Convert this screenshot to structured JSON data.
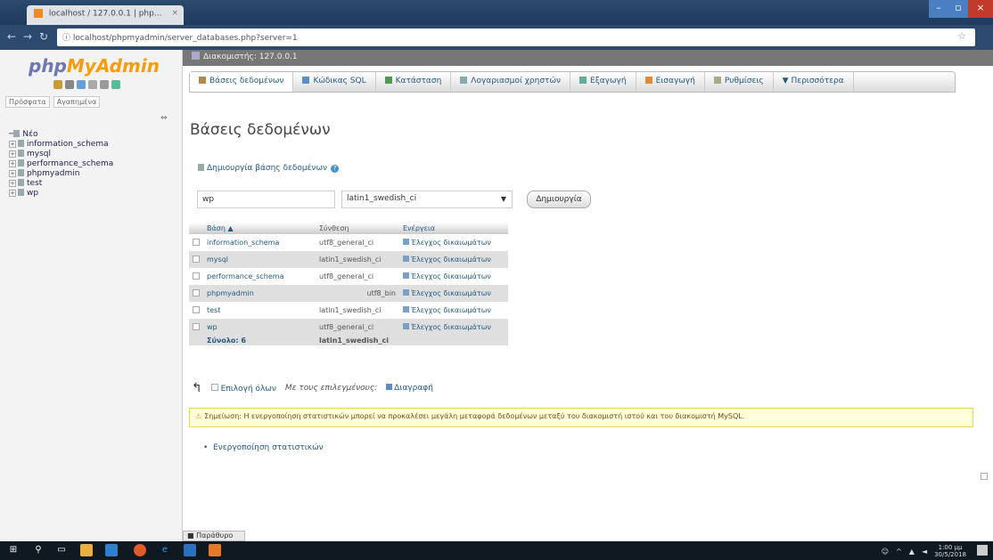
{
  "browser": {
    "tab_title": "localhost / 127.0.0.1 | php...",
    "address": "localhost/phpmyadmin/server_databases.php?server=1"
  },
  "sidebar": {
    "logo_part1": "php",
    "logo_part2": "MyAdmin",
    "tabs": [
      "Πρόσφατα",
      "Αγαπημένα"
    ],
    "tree": [
      "Νέο",
      "information_schema",
      "mysql",
      "performance_schema",
      "phpmyadmin",
      "test",
      "wp"
    ]
  },
  "breadcrumb": "Διακομιστής: 127.0.0.1",
  "menu": [
    {
      "label": "Βάσεις δεδομένων",
      "color": "#b08a4a"
    },
    {
      "label": "Κώδικας SQL",
      "color": "#5d8fc7"
    },
    {
      "label": "Κατάσταση",
      "color": "#4d9a50"
    },
    {
      "label": "Λογαριασμοί χρηστών",
      "color": "#8aa"
    },
    {
      "label": "Εξαγωγή",
      "color": "#6a9"
    },
    {
      "label": "Εισαγωγή",
      "color": "#e08a3a"
    },
    {
      "label": "Ρυθμίσεις",
      "color": "#aa8"
    },
    {
      "label": "Περισσότερα",
      "color": "#999"
    }
  ],
  "page_title": "Βάσεις δεδομένων",
  "create": {
    "link_label": "Δημιουργία βάσης δεδομένων",
    "db_name_value": "wp",
    "collation_value": "latin1_swedish_ci",
    "button_label": "Δημιουργία"
  },
  "table": {
    "headers": [
      "Βάση",
      "Σύνθεση",
      "Ενέργεια"
    ],
    "sort_indicator": "▲",
    "rows": [
      {
        "name": "information_schema",
        "collation": "utf8_general_ci",
        "action": "Έλεγχος δικαιωμάτων"
      },
      {
        "name": "mysql",
        "collation": "latin1_swedish_ci",
        "action": "Έλεγχος δικαιωμάτων"
      },
      {
        "name": "performance_schema",
        "collation": "utf8_general_ci",
        "action": "Έλεγχος δικαιωμάτων"
      },
      {
        "name": "phpmyadmin",
        "collation": "utf8_bin",
        "action": "Έλεγχος δικαιωμάτων"
      },
      {
        "name": "test",
        "collation": "latin1_swedish_ci",
        "action": "Έλεγχος δικαιωμάτων"
      },
      {
        "name": "wp",
        "collation": "utf8_general_ci",
        "action": "Έλεγχος δικαιωμάτων"
      }
    ],
    "total_label": "Σύνολο: 6",
    "total_collation": "latin1_swedish_ci"
  },
  "bulk": {
    "select_all": "Επιλογή όλων",
    "with_selected": "Με τους επιλεγμένους:",
    "drop": "Διαγραφή"
  },
  "notice": "Σημείωση: Η ενεργοποίηση στατιστικών μπορεί να προκαλέσει μεγάλη μεταφορά δεδομένων μεταξύ του διακομιστή ιστού και του διακομιστή MySQL.",
  "enable_stats": "Ενεργοποίηση στατιστικών",
  "console": "Παράθυρο",
  "taskbar": {
    "time": "1:00 μμ",
    "date": "30/5/2018"
  }
}
